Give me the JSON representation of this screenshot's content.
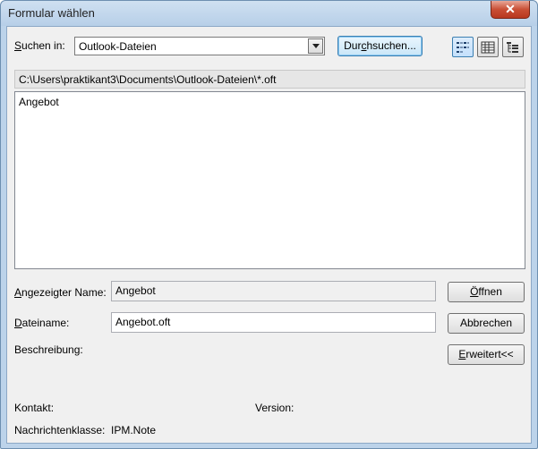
{
  "window": {
    "title": "Formular wählen",
    "close_glyph": "✕"
  },
  "lookin": {
    "label_prefix": "",
    "label_access": "S",
    "label_rest": "uchen in:",
    "value": "Outlook-Dateien"
  },
  "browse": {
    "pre": "Dur",
    "access": "c",
    "post": "hsuchen..."
  },
  "views": [
    "list-view-icon",
    "details-view-icon",
    "tree-view-icon"
  ],
  "path": "C:\\Users\\praktikant3\\Documents\\Outlook-Dateien\\*.oft",
  "items": [
    "Angebot"
  ],
  "display_name": {
    "access": "A",
    "rest": "ngezeigter Name:",
    "value": "Angebot"
  },
  "filename": {
    "access": "D",
    "rest": "ateiname:",
    "value": "Angebot.oft"
  },
  "description_label": "Beschreibung:",
  "contact_label": "Kontakt:",
  "version_label": "Version:",
  "message_class_label": "Nachrichtenklasse:",
  "message_class_value": "IPM.Note",
  "buttons": {
    "open": {
      "access": "Ö",
      "rest": "ffnen"
    },
    "cancel": "Abbrechen",
    "advanced": {
      "access": "E",
      "rest": "rweitert<<"
    }
  }
}
